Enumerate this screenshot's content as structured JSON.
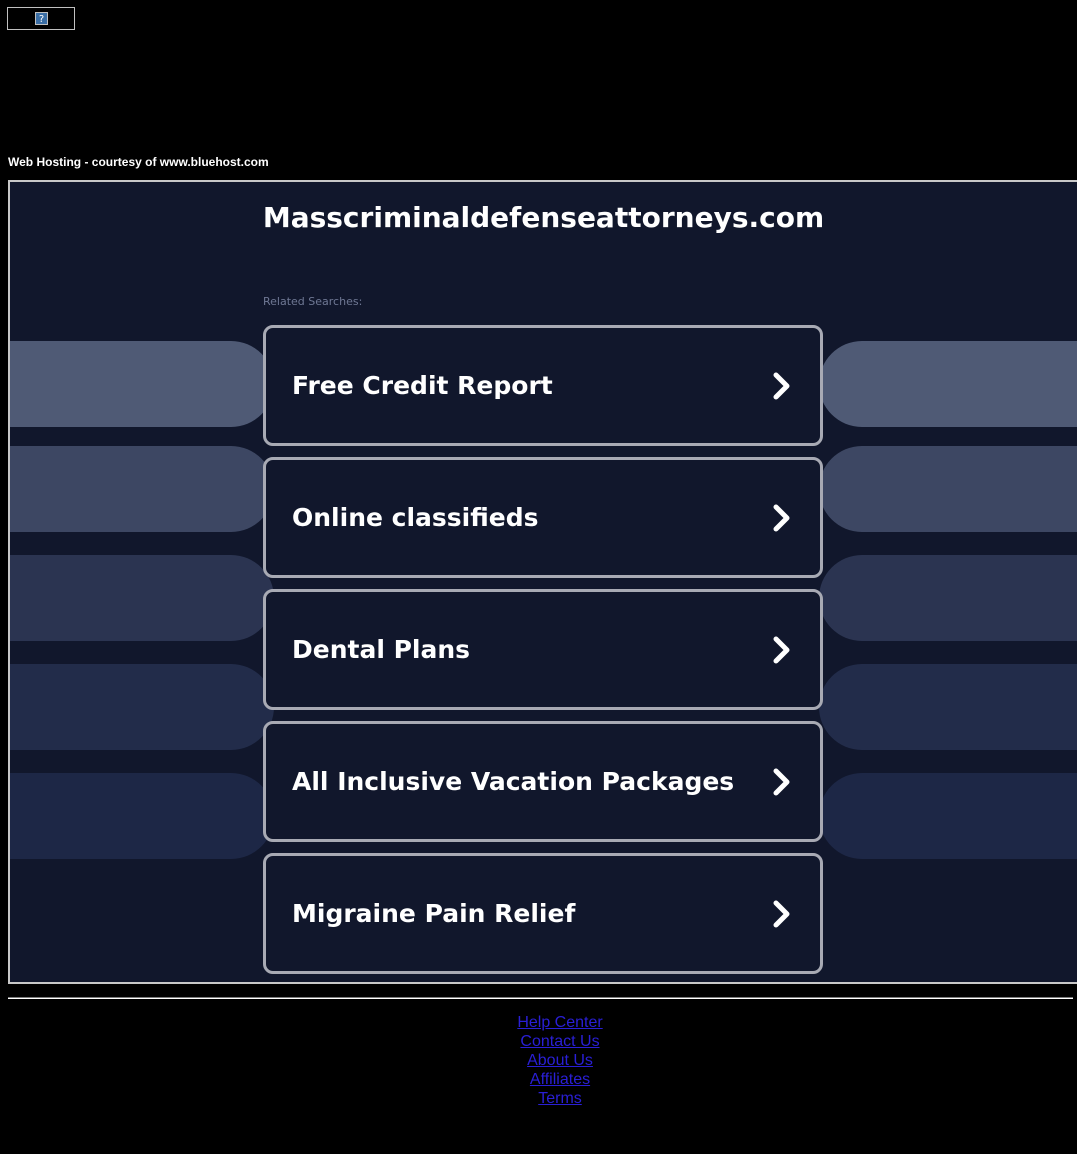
{
  "top_image": {
    "glyph": "?"
  },
  "hosting_note": "Web Hosting - courtesy of www.bluehost.com",
  "domain_title": "Masscriminaldefenseattorneys.com",
  "related_label": "Related Searches:",
  "search_items": [
    {
      "label": "Free Credit Report"
    },
    {
      "label": "Online classifieds"
    },
    {
      "label": "Dental Plans"
    },
    {
      "label": "All Inclusive Vacation Packages"
    },
    {
      "label": "Migraine Pain Relief"
    }
  ],
  "footer_links": [
    {
      "label": "Help Center"
    },
    {
      "label": "Contact Us"
    },
    {
      "label": "About Us"
    },
    {
      "label": "Affiliates"
    },
    {
      "label": "Terms"
    }
  ],
  "colors": {
    "page_background": "#000000",
    "frame_background": "#11172c",
    "band_colors": [
      "#4f5a75",
      "#3d4763",
      "#2b3451",
      "#222c4a",
      "#1d2746"
    ],
    "item_border": "#a8aab4",
    "link": "#2a1fd6"
  },
  "icons": {
    "broken_image": "question-mark-icon",
    "item_arrow": "chevron-right-icon"
  }
}
